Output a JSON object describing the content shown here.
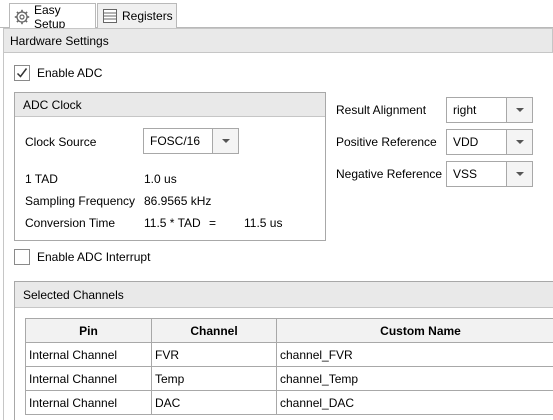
{
  "tabs": [
    {
      "label": "Easy Setup",
      "icon": "gear-icon",
      "active": true
    },
    {
      "label": "Registers",
      "icon": "registers-icon",
      "active": false
    }
  ],
  "hardware_settings": {
    "title": "Hardware Settings"
  },
  "enable_adc": {
    "label": "Enable ADC",
    "checked": true
  },
  "adc_clock": {
    "title": "ADC Clock",
    "clock_source_label": "Clock Source",
    "clock_source_value": "FOSC/16",
    "tad_label": "1 TAD",
    "tad_value": "1.0 us",
    "sampling_label": "Sampling Frequency",
    "sampling_value": "86.9565 kHz",
    "conversion_label": "Conversion Time",
    "conversion_formula": "11.5 * TAD",
    "conversion_eq": "=",
    "conversion_value": "11.5 us"
  },
  "result_alignment": {
    "label": "Result Alignment",
    "value": "right"
  },
  "positive_reference": {
    "label": "Positive Reference",
    "value": "VDD"
  },
  "negative_reference": {
    "label": "Negative Reference",
    "value": "VSS"
  },
  "enable_interrupt": {
    "label": "Enable ADC Interrupt",
    "checked": false
  },
  "selected_channels": {
    "title": "Selected Channels",
    "columns": [
      "Pin",
      "Channel",
      "Custom Name"
    ],
    "rows": [
      [
        "Internal Channel",
        "FVR",
        "channel_FVR"
      ],
      [
        "Internal Channel",
        "Temp",
        "channel_Temp"
      ],
      [
        "Internal Channel",
        "DAC",
        "channel_DAC"
      ]
    ]
  }
}
